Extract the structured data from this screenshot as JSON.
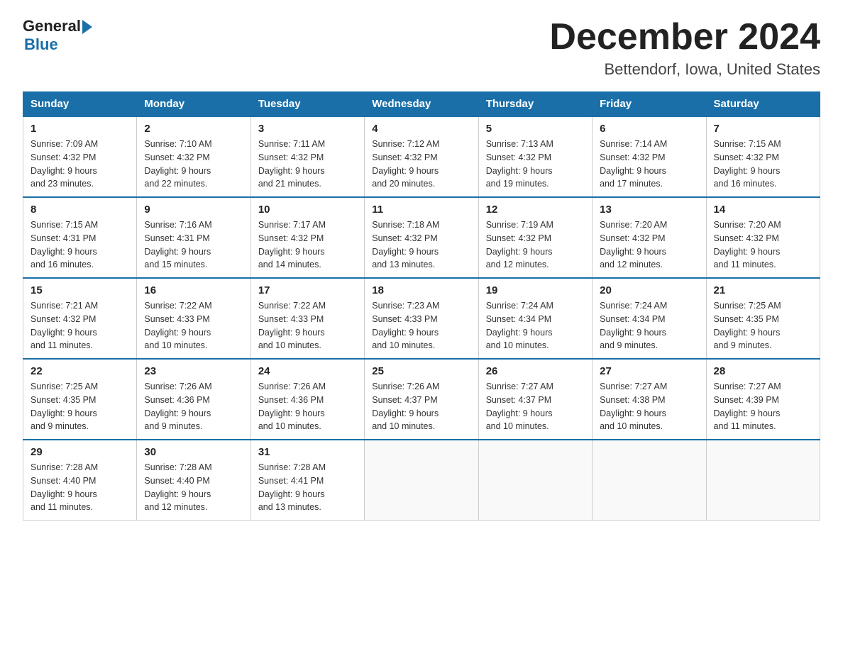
{
  "header": {
    "logo_general": "General",
    "logo_blue": "Blue",
    "month_title": "December 2024",
    "location": "Bettendorf, Iowa, United States"
  },
  "days_of_week": [
    "Sunday",
    "Monday",
    "Tuesday",
    "Wednesday",
    "Thursday",
    "Friday",
    "Saturday"
  ],
  "weeks": [
    [
      {
        "day": "1",
        "sunrise": "7:09 AM",
        "sunset": "4:32 PM",
        "daylight": "9 hours and 23 minutes."
      },
      {
        "day": "2",
        "sunrise": "7:10 AM",
        "sunset": "4:32 PM",
        "daylight": "9 hours and 22 minutes."
      },
      {
        "day": "3",
        "sunrise": "7:11 AM",
        "sunset": "4:32 PM",
        "daylight": "9 hours and 21 minutes."
      },
      {
        "day": "4",
        "sunrise": "7:12 AM",
        "sunset": "4:32 PM",
        "daylight": "9 hours and 20 minutes."
      },
      {
        "day": "5",
        "sunrise": "7:13 AM",
        "sunset": "4:32 PM",
        "daylight": "9 hours and 19 minutes."
      },
      {
        "day": "6",
        "sunrise": "7:14 AM",
        "sunset": "4:32 PM",
        "daylight": "9 hours and 17 minutes."
      },
      {
        "day": "7",
        "sunrise": "7:15 AM",
        "sunset": "4:32 PM",
        "daylight": "9 hours and 16 minutes."
      }
    ],
    [
      {
        "day": "8",
        "sunrise": "7:15 AM",
        "sunset": "4:31 PM",
        "daylight": "9 hours and 16 minutes."
      },
      {
        "day": "9",
        "sunrise": "7:16 AM",
        "sunset": "4:31 PM",
        "daylight": "9 hours and 15 minutes."
      },
      {
        "day": "10",
        "sunrise": "7:17 AM",
        "sunset": "4:32 PM",
        "daylight": "9 hours and 14 minutes."
      },
      {
        "day": "11",
        "sunrise": "7:18 AM",
        "sunset": "4:32 PM",
        "daylight": "9 hours and 13 minutes."
      },
      {
        "day": "12",
        "sunrise": "7:19 AM",
        "sunset": "4:32 PM",
        "daylight": "9 hours and 12 minutes."
      },
      {
        "day": "13",
        "sunrise": "7:20 AM",
        "sunset": "4:32 PM",
        "daylight": "9 hours and 12 minutes."
      },
      {
        "day": "14",
        "sunrise": "7:20 AM",
        "sunset": "4:32 PM",
        "daylight": "9 hours and 11 minutes."
      }
    ],
    [
      {
        "day": "15",
        "sunrise": "7:21 AM",
        "sunset": "4:32 PM",
        "daylight": "9 hours and 11 minutes."
      },
      {
        "day": "16",
        "sunrise": "7:22 AM",
        "sunset": "4:33 PM",
        "daylight": "9 hours and 10 minutes."
      },
      {
        "day": "17",
        "sunrise": "7:22 AM",
        "sunset": "4:33 PM",
        "daylight": "9 hours and 10 minutes."
      },
      {
        "day": "18",
        "sunrise": "7:23 AM",
        "sunset": "4:33 PM",
        "daylight": "9 hours and 10 minutes."
      },
      {
        "day": "19",
        "sunrise": "7:24 AM",
        "sunset": "4:34 PM",
        "daylight": "9 hours and 10 minutes."
      },
      {
        "day": "20",
        "sunrise": "7:24 AM",
        "sunset": "4:34 PM",
        "daylight": "9 hours and 9 minutes."
      },
      {
        "day": "21",
        "sunrise": "7:25 AM",
        "sunset": "4:35 PM",
        "daylight": "9 hours and 9 minutes."
      }
    ],
    [
      {
        "day": "22",
        "sunrise": "7:25 AM",
        "sunset": "4:35 PM",
        "daylight": "9 hours and 9 minutes."
      },
      {
        "day": "23",
        "sunrise": "7:26 AM",
        "sunset": "4:36 PM",
        "daylight": "9 hours and 9 minutes."
      },
      {
        "day": "24",
        "sunrise": "7:26 AM",
        "sunset": "4:36 PM",
        "daylight": "9 hours and 10 minutes."
      },
      {
        "day": "25",
        "sunrise": "7:26 AM",
        "sunset": "4:37 PM",
        "daylight": "9 hours and 10 minutes."
      },
      {
        "day": "26",
        "sunrise": "7:27 AM",
        "sunset": "4:37 PM",
        "daylight": "9 hours and 10 minutes."
      },
      {
        "day": "27",
        "sunrise": "7:27 AM",
        "sunset": "4:38 PM",
        "daylight": "9 hours and 10 minutes."
      },
      {
        "day": "28",
        "sunrise": "7:27 AM",
        "sunset": "4:39 PM",
        "daylight": "9 hours and 11 minutes."
      }
    ],
    [
      {
        "day": "29",
        "sunrise": "7:28 AM",
        "sunset": "4:40 PM",
        "daylight": "9 hours and 11 minutes."
      },
      {
        "day": "30",
        "sunrise": "7:28 AM",
        "sunset": "4:40 PM",
        "daylight": "9 hours and 12 minutes."
      },
      {
        "day": "31",
        "sunrise": "7:28 AM",
        "sunset": "4:41 PM",
        "daylight": "9 hours and 13 minutes."
      },
      null,
      null,
      null,
      null
    ]
  ],
  "labels": {
    "sunrise": "Sunrise:",
    "sunset": "Sunset:",
    "daylight": "Daylight:"
  }
}
